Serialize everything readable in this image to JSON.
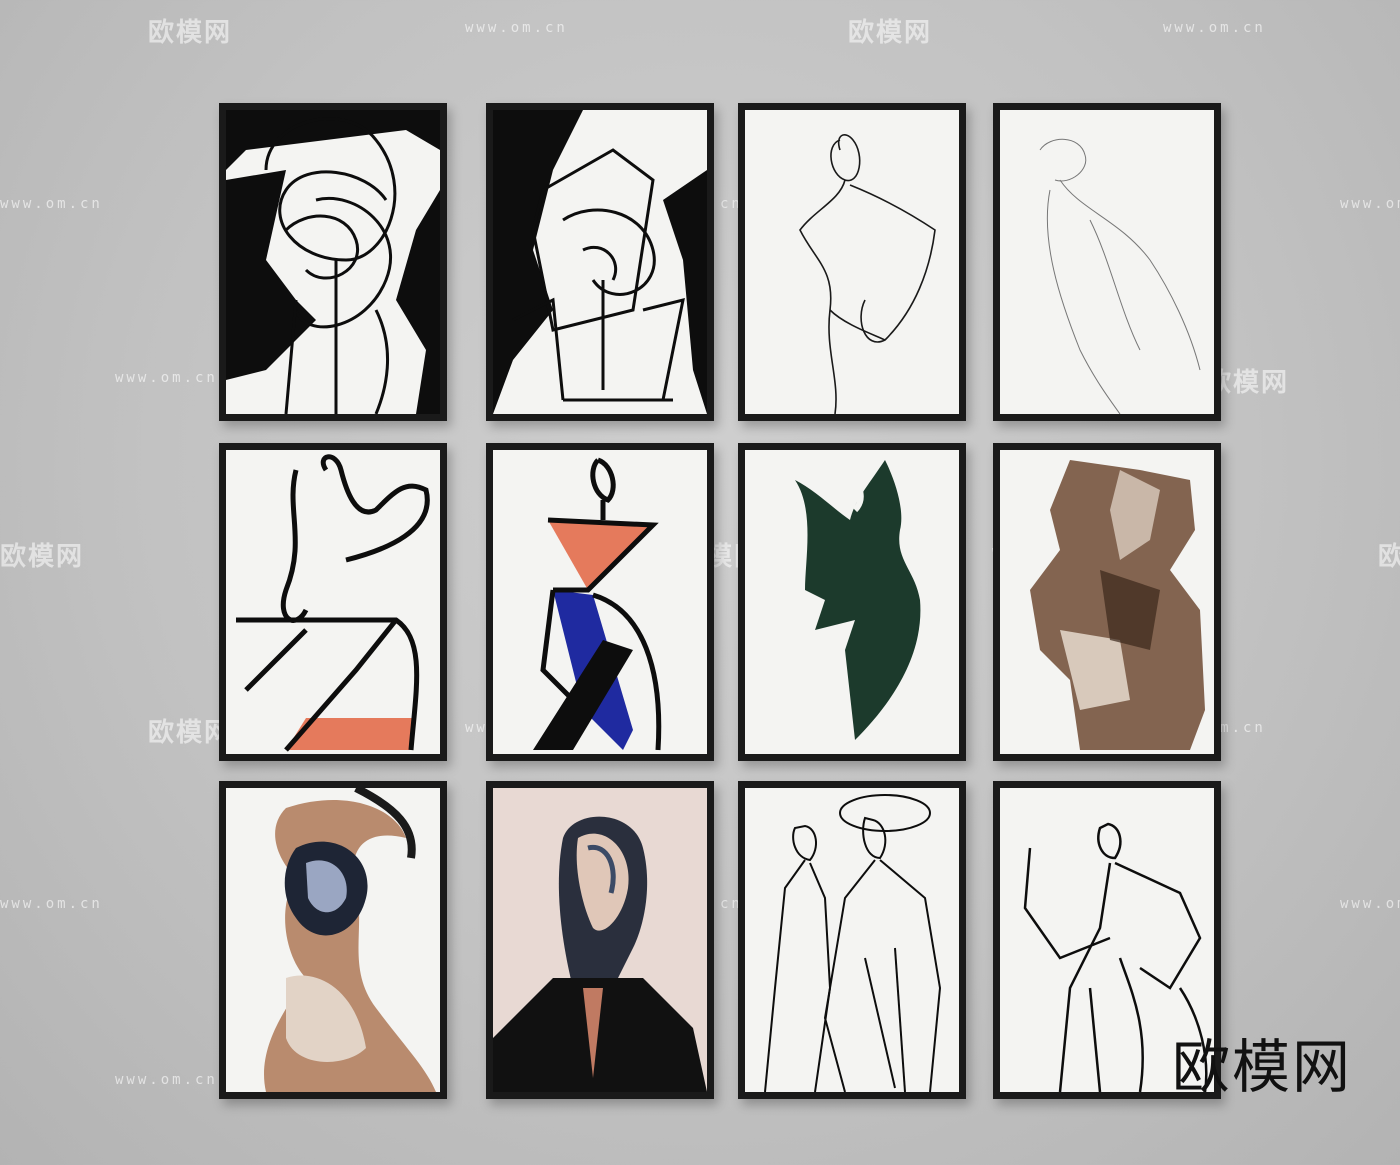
{
  "watermark": {
    "brand_text": "欧模网",
    "url_text": "www.om.cn"
  },
  "colors": {
    "wall": "#c4c4c4",
    "frame": "#1a1a1a",
    "paper": "#f4f4f2",
    "coral": "#e57a5c",
    "blue": "#1f2aa0",
    "green": "#1c3a2c",
    "brown": "#6e4a34"
  },
  "paintings": [
    {
      "row": 1,
      "col": 1,
      "style": "abstract line faces on black and white"
    },
    {
      "row": 1,
      "col": 2,
      "style": "abstract line faces on black and white"
    },
    {
      "row": 1,
      "col": 3,
      "style": "single line female figure"
    },
    {
      "row": 1,
      "col": 4,
      "style": "faint line female figure"
    },
    {
      "row": 2,
      "col": 1,
      "style": "line figure with coral block"
    },
    {
      "row": 2,
      "col": 2,
      "style": "figure with coral and blue blocks"
    },
    {
      "row": 2,
      "col": 3,
      "style": "dark green brushed silhouette"
    },
    {
      "row": 2,
      "col": 4,
      "style": "brown brushed silhouette"
    },
    {
      "row": 3,
      "col": 1,
      "style": "fluid marbled figure"
    },
    {
      "row": 3,
      "col": 2,
      "style": "marbled head portrait on pink"
    },
    {
      "row": 3,
      "col": 3,
      "style": "two line figures"
    },
    {
      "row": 3,
      "col": 4,
      "style": "line figure with raised arm"
    }
  ]
}
